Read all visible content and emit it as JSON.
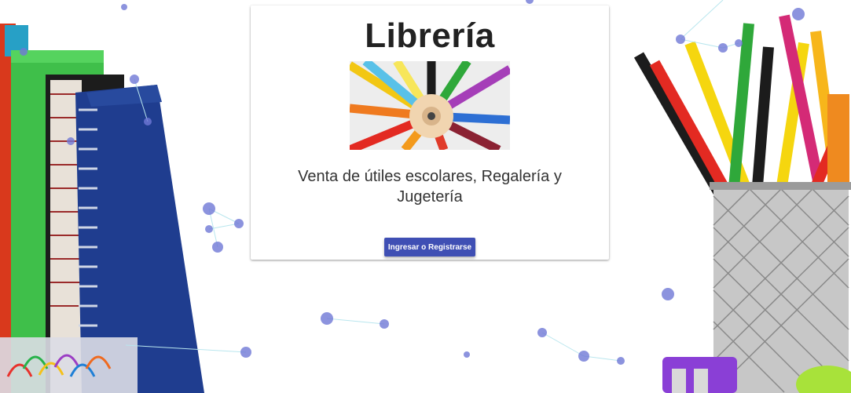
{
  "card": {
    "title": "Librería",
    "subtitle": "Venta de útiles escolares, Regalería y Jugetería",
    "button_label": "Ingresar o Registrarse"
  },
  "colors": {
    "accent": "#3f4fb4",
    "particle": "#6f78d6",
    "particle_line": "#b9e6ee"
  }
}
